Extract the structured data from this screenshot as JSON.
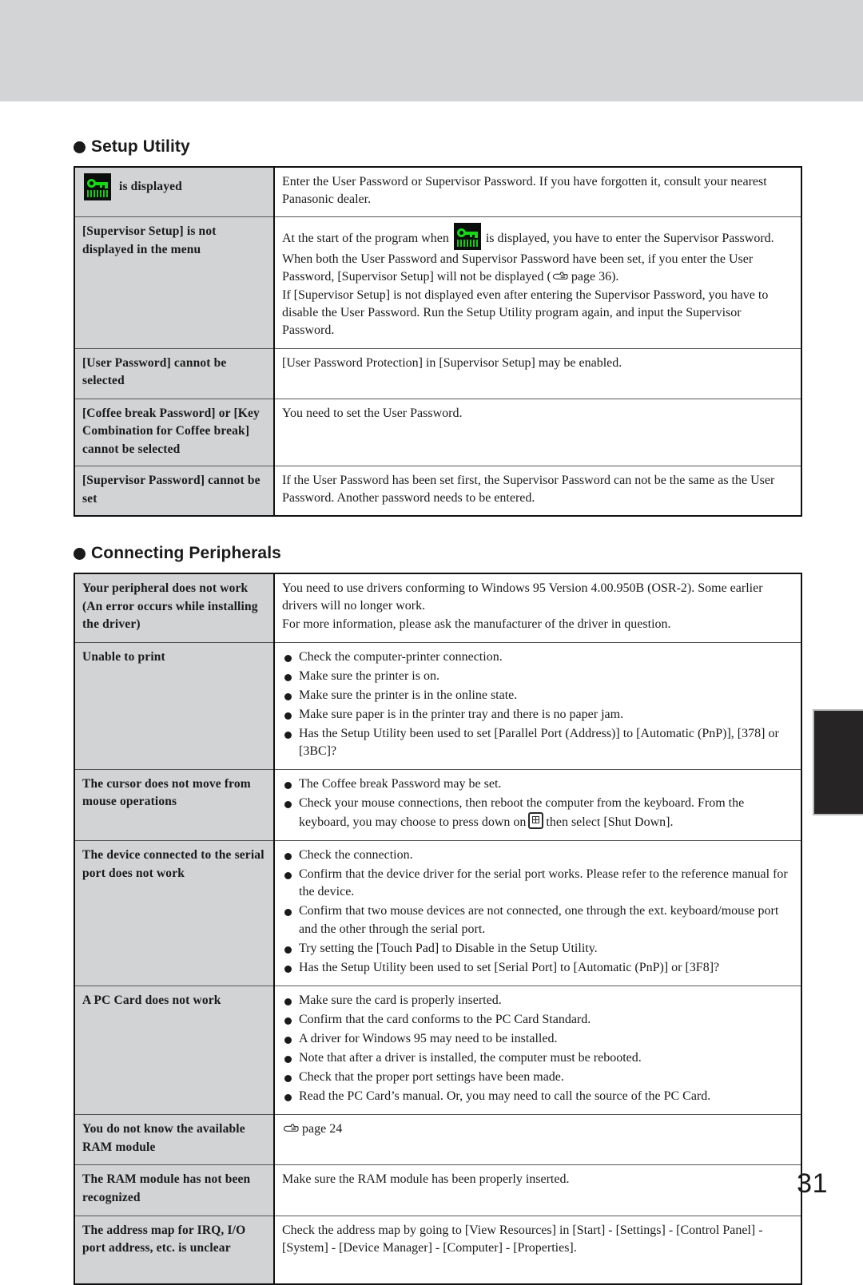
{
  "page": {
    "number": "31"
  },
  "sections": [
    {
      "id": "setup-utility",
      "title": "Setup Utility",
      "rows": [
        {
          "symptom": "is displayed",
          "symptom_icon": "password-key-icon",
          "blocks": [
            {
              "type": "paragraph",
              "text": "Enter the User Password or Supervisor Password. If you have forgotten it, consult your nearest Panasonic dealer."
            }
          ]
        },
        {
          "symptom": "[Supervisor Setup] is not displayed in the menu",
          "blocks": [
            {
              "type": "paragraph-icon",
              "text_before": "At the start of the program when",
              "icon": "password-key-icon",
              "text_after": "is displayed, you have to enter the Supervisor Password."
            },
            {
              "type": "paragraph-seepage",
              "text_before": "When both the User Password and Supervisor Password have been set,  if you enter the User Password, [Supervisor Setup] will not be displayed (",
              "page_ref": "page 36",
              "text_after": ")."
            },
            {
              "type": "paragraph",
              "text": "If [Supervisor Setup] is not displayed even after entering the Supervisor Password, you have to disable the User Password. Run the Setup Utility program again, and input the Supervisor Password."
            }
          ]
        },
        {
          "symptom": "[User Password] cannot be selected",
          "blocks": [
            {
              "type": "paragraph",
              "text": "[User Password Protection] in [Supervisor Setup] may be enabled."
            }
          ]
        },
        {
          "symptom": "[Coffee break Password] or [Key Combination for Coffee break] cannot be selected",
          "blocks": [
            {
              "type": "paragraph",
              "text": "You need to set the User Password."
            }
          ]
        },
        {
          "symptom": "[Supervisor Password] cannot be set",
          "blocks": [
            {
              "type": "paragraph",
              "text": "If the User Password has been set first, the Supervisor Password can not be the same as the User Password.  Another password needs to be entered."
            }
          ]
        }
      ]
    },
    {
      "id": "connecting-peripherals",
      "title": "Connecting Peripherals",
      "rows": [
        {
          "symptom": "Your peripheral does not work (An error occurs while installing the driver)",
          "blocks": [
            {
              "type": "paragraph",
              "text": "You need to use drivers conforming to Windows 95 Version 4.00.950B (OSR-2).  Some earlier drivers will no longer work."
            },
            {
              "type": "paragraph",
              "text": "For more information, please ask the manufacturer of the driver in question."
            }
          ]
        },
        {
          "symptom": "Unable to print",
          "blocks": [
            {
              "type": "bullets",
              "items": [
                "Check the computer-printer connection.",
                "Make sure the printer is on.",
                "Make sure the printer is in the online state.",
                "Make sure paper is in the printer tray and there is no paper jam.",
                "Has the Setup Utility been used to set [Parallel Port (Address)] to [Automatic (PnP)], [378] or [3BC]?"
              ]
            }
          ]
        },
        {
          "symptom": "The cursor does not move from mouse operations",
          "blocks": [
            {
              "type": "bullets-with-winkey",
              "items": [
                "The Coffee break Password may be set."
              ],
              "winkey_item_before": "Check your mouse connections, then reboot the computer from the keyboard. From the keyboard, you may choose to press down on",
              "winkey_icon": "windows-key-icon",
              "winkey_item_after": "then select [Shut Down]."
            }
          ]
        },
        {
          "symptom": "The device connected to the serial port does not work",
          "blocks": [
            {
              "type": "bullets",
              "items": [
                "Check the connection.",
                "Confirm that the device driver for the serial port works.  Please refer to the reference manual for the device.",
                "Confirm that two mouse devices are not connected, one through the ext. keyboard/mouse port and the other through the serial port.",
                "Try setting the [Touch Pad] to Disable in the Setup Utility.",
                "Has the Setup Utility been used to set [Serial Port] to [Automatic (PnP)] or [3F8]?"
              ]
            }
          ]
        },
        {
          "symptom": "A PC Card does not work",
          "blocks": [
            {
              "type": "bullets",
              "items": [
                "Make sure the card is properly inserted.",
                "Confirm that the card conforms to the PC Card Standard.",
                "A driver for Windows 95 may need to be installed.",
                "Note that after a driver is installed, the computer must be rebooted.",
                "Check that the proper port settings have been made.",
                "Read the PC Card’s manual.  Or, you may need to call the source of the PC Card."
              ]
            }
          ]
        },
        {
          "symptom": "You do not know the available RAM module",
          "blocks": [
            {
              "type": "seepage-only",
              "page_ref": "page 24"
            }
          ]
        },
        {
          "symptom": "The RAM module has not been recognized",
          "blocks": [
            {
              "type": "paragraph",
              "text": "Make sure the RAM module has been properly inserted."
            }
          ]
        },
        {
          "symptom": "The address map for IRQ, I/O port address, etc. is unclear",
          "blocks": [
            {
              "type": "paragraph",
              "text": "Check the address map by going to [View Resources] in [Start] - [Settings] - [Control Panel] - [System] - [Device Manager] - [Computer] - [Properties]."
            }
          ]
        }
      ]
    }
  ],
  "colors": {
    "band": "#d2d4d6",
    "symptom_cell": "#d2d3d4",
    "tab": "#262425",
    "key_green": "#16d916"
  }
}
